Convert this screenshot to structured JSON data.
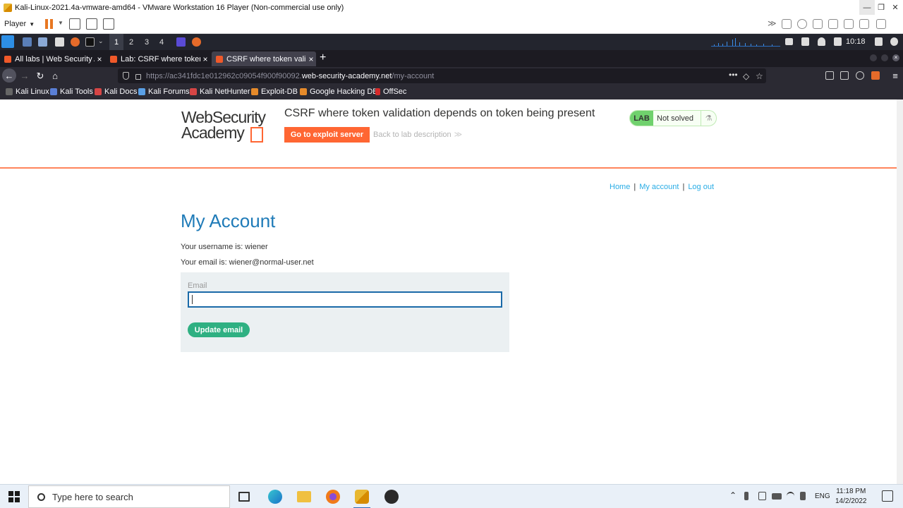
{
  "vm_window": {
    "title": "Kali-Linux-2021.4a-vmware-amd64 - VMware Workstation 16 Player (Non-commercial use only)",
    "player_menu": "Player",
    "min_glyph": "—",
    "max_glyph": "❐",
    "close_glyph": "✕"
  },
  "kali_panel": {
    "workspaces": [
      "1",
      "2",
      "3",
      "4"
    ],
    "active_workspace": "1",
    "clock": "10:18"
  },
  "browser": {
    "tabs": [
      {
        "label": "All labs | Web Security Academy",
        "active": false
      },
      {
        "label": "Lab: CSRF where token validation",
        "active": false
      },
      {
        "label": "CSRF where token validation",
        "active": true
      }
    ],
    "new_tab_glyph": "+",
    "url_prefix": "https://ac341fdc1e012962c09054f900f90092.",
    "url_host": "web-security-academy.net",
    "url_path": "/my-account",
    "bookmarks": [
      "Kali Linux",
      "Kali Tools",
      "Kali Docs",
      "Kali Forums",
      "Kali NetHunter",
      "Exploit-DB",
      "Google Hacking DB",
      "OffSec"
    ]
  },
  "lab_header": {
    "logo_line1": "WebSecurity",
    "logo_line2": "Academy",
    "title": "CSRF where token validation depends on token being present",
    "exploit_button": "Go to exploit server",
    "back_link": "Back to lab description",
    "back_chevrons": "≫",
    "status_badge": "LAB",
    "status_text": "Not solved",
    "accent_color": "#ff6633"
  },
  "nav_links": {
    "home": "Home",
    "my_account": "My account",
    "log_out": "Log out",
    "separator": "|"
  },
  "account": {
    "heading": "My Account",
    "username_line": "Your username is: wiener",
    "email_line": "Your email is: wiener@normal-user.net",
    "email_label": "Email",
    "email_value": "",
    "update_button": "Update email"
  },
  "taskbar": {
    "search_placeholder": "Type here to search",
    "language": "ENG",
    "time": "11:18 PM",
    "date": "14/2/2022"
  }
}
